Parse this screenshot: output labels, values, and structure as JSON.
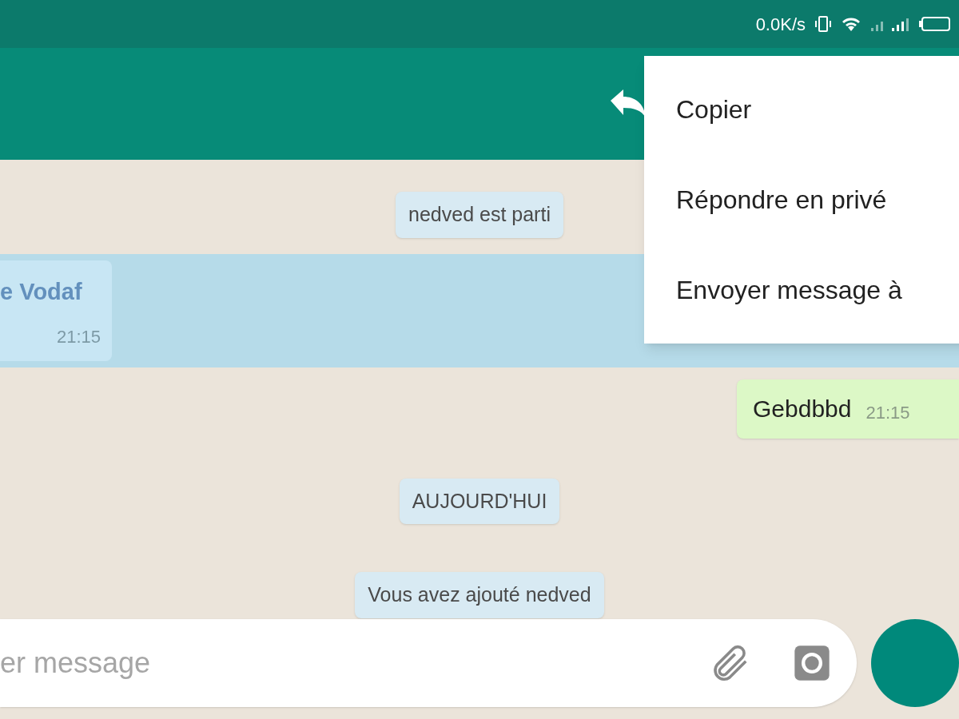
{
  "status_bar": {
    "network_speed": "0.0K/s"
  },
  "context_menu": {
    "items": [
      {
        "label": "Copier"
      },
      {
        "label": "Répondre en privé"
      },
      {
        "label": "Envoyer message à"
      }
    ]
  },
  "messages": [
    {
      "kind": "system",
      "text": "nedved est parti"
    },
    {
      "kind": "incoming",
      "sender": "e Vodaf",
      "time": "21:15",
      "selected": true
    },
    {
      "kind": "outgoing",
      "text": "Gebdbbd",
      "time": "21:15",
      "selected": false
    },
    {
      "kind": "system",
      "text": "AUJOURD'HUI"
    },
    {
      "kind": "system",
      "text": "Vous avez ajouté nedved"
    }
  ],
  "composer": {
    "placeholder": "er message"
  }
}
